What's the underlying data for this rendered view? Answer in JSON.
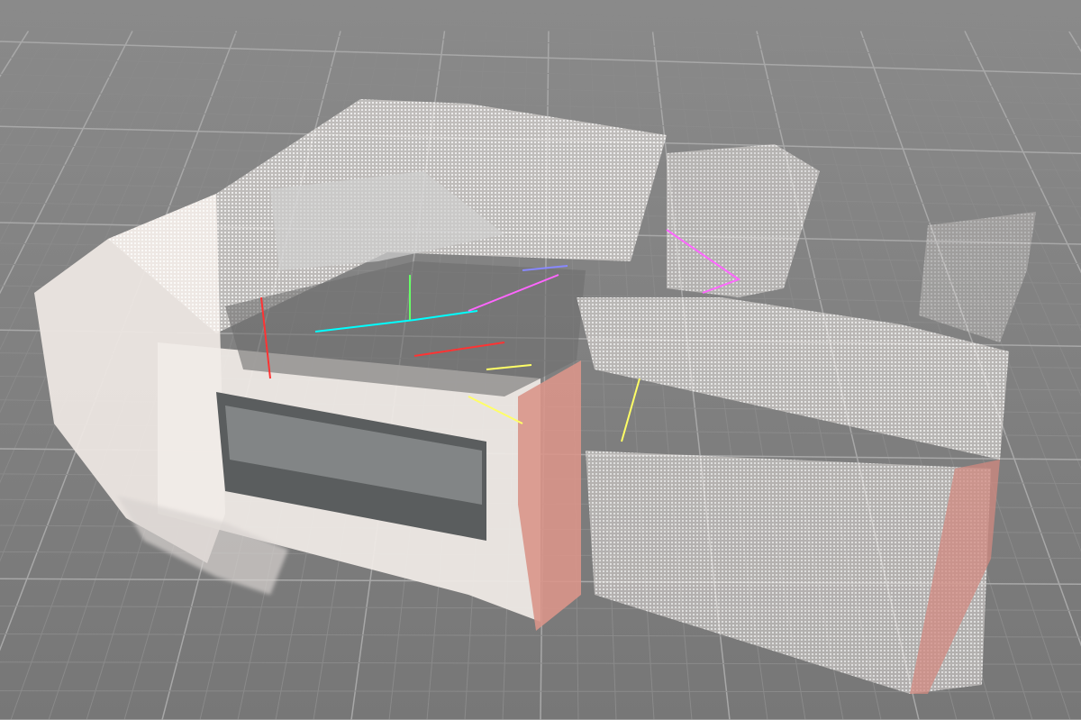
{
  "viewer": {
    "background_color": "#7b7b7b",
    "grid_minor_color": "#8a8a8a",
    "grid_major_color": "#a8a8a8",
    "point_cloud_color": "#f4efec",
    "accent_wall_color": "#d9958a",
    "camera_path_colors": [
      "#ffff66",
      "#00ffff",
      "#ff00ff",
      "#ff3333",
      "#66ff66",
      "#8888ff"
    ]
  }
}
